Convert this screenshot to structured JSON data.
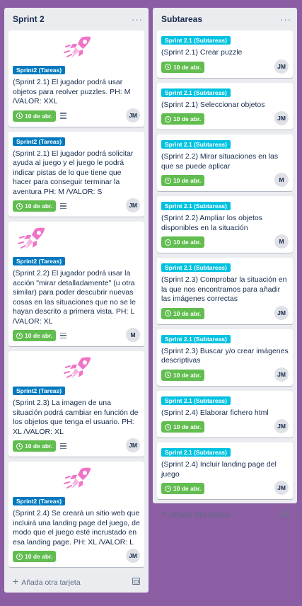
{
  "lists": [
    {
      "title": "Sprint 2",
      "menu": "···",
      "add_card": "Añada otra tarjeta",
      "cards": [
        {
          "label": "Sprint2 (Tareas)",
          "text": "(Sprint 2.1) El jugador podrá usar objetos para reolver puzzles. PH: M /VALOR: XXL",
          "due": "10 de abr.",
          "avatar": "JM"
        },
        {
          "label": "Sprint2 (Tareas)",
          "text": "(Sprint 2.1) El jugador podrá solicitar ayuda al juego y el juego le podrá indicar pistas de lo que tiene que hacer para conseguir terminar la aventura PH: M /VALOR: S",
          "due": "10 de abr.",
          "avatar": "JM"
        },
        {
          "label": "Sprint2 (Tareas)",
          "text": "(Sprint 2.2) El jugador podrá usar la acción \"mirar detalladamente\" (u otra similar) para poder descubrir nuevas cosas en las situaciones que no se le hayan descrito a primera vista. PH: L /VALOR: XL",
          "due": "10 de abr.",
          "avatar": "M"
        },
        {
          "label": "Sprint2 (Tareas)",
          "text": "(Sprint 2.3) La imagen de una situación podrá cambiar en función de los objetos que tenga el usuario. PH: XL /VALOR: XL",
          "due": "10 de abr.",
          "avatar": "JM"
        },
        {
          "label": "Sprint2 (Tareas)",
          "text": "(Sprint 2.4) Se creará un sitio web que incluirá una landing page del juego, de modo que el juego esté incrustado en esa landing page. PH: XL /VALOR: L",
          "due": "10 de abr.",
          "avatar": "JM"
        }
      ]
    },
    {
      "title": "Subtareas",
      "menu": "···",
      "add_card": "Añada otra tarjeta",
      "cards": [
        {
          "label": "Sprint 2.1 (Subtareas)",
          "text": "(Sprint 2.1) Crear puzzle",
          "due": "10 de abr.",
          "avatar": "JM"
        },
        {
          "label": "Sprint 2.1 (Subtareas)",
          "text": "(Sprint 2.1) Seleccionar objetos",
          "due": "10 de abr.",
          "avatar": "JM"
        },
        {
          "label": "Sprint 2.1 (Subtareas)",
          "text": "(Sprint 2.2) Mirar situaciones en las que se puede aplicar",
          "due": "10 de abr.",
          "avatar": "M"
        },
        {
          "label": "Sprint 2.1 (Subtareas)",
          "text": "(Sprint 2.2) Ampliar los objetos disponibles en la situación",
          "due": "10 de abr.",
          "avatar": "M"
        },
        {
          "label": "Sprint 2.1 (Subtareas)",
          "text": "(Sprint 2.3) Comprobar la situación en la que nos encontramos para añadir las imágenes correctas",
          "due": "10 de abr.",
          "avatar": "JM"
        },
        {
          "label": "Sprint 2.1 (Subtareas)",
          "text": "(Sprint 2.3) Buscar y/o crear imágenes descriptivas",
          "due": "10 de abr.",
          "avatar": "JM"
        },
        {
          "label": "Sprint 2.1 (Subtareas)",
          "text": "(Sprint 2.4) Elaborar fichero html",
          "due": "10 de abr.",
          "avatar": "JM"
        },
        {
          "label": "Sprint 2.1 (Subtareas)",
          "text": "(Sprint 2.4) Incluir landing page del juego",
          "due": "10 de abr.",
          "avatar": "JM"
        }
      ]
    }
  ],
  "colors": {
    "board": "#8b5ea4",
    "label_blue": "#0079bf",
    "label_cyan": "#00c2e0",
    "due_green": "#61bd4f"
  },
  "icons": [
    "rocket-icon",
    "clock-icon",
    "description-icon",
    "plus-icon",
    "template-icon"
  ]
}
